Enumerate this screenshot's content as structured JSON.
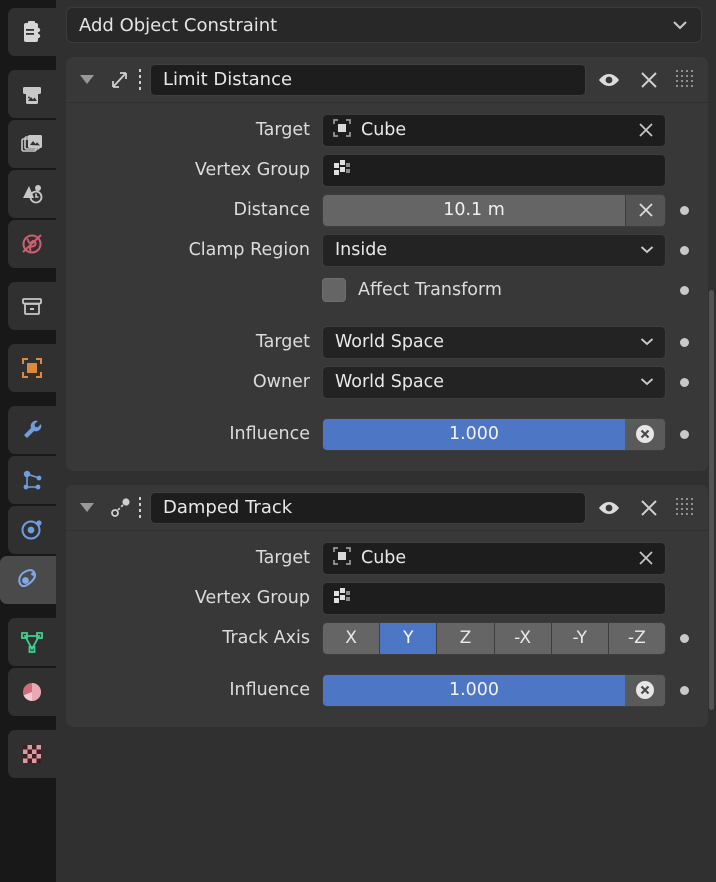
{
  "theme": {
    "accent_blue": "#4d76c4",
    "panel_bg": "#383838",
    "area_bg": "#303030",
    "field_bg": "#1d1d1d",
    "slider_track": "#656565"
  },
  "tabstrip": {
    "items": [
      {
        "name": "tool",
        "icon": "tool-clipboard-icon",
        "active": false
      },
      {
        "name": "render",
        "icon": "render-camera-icon",
        "active": false
      },
      {
        "name": "output",
        "icon": "output-printer-icon",
        "active": false
      },
      {
        "name": "view-layer",
        "icon": "view-layer-images-icon",
        "active": false
      },
      {
        "name": "scene",
        "icon": "scene-cone-icon",
        "active": false
      },
      {
        "name": "world",
        "icon": "world-globe-icon",
        "active": false
      },
      {
        "name": "collection",
        "icon": "collection-box-icon",
        "active": false
      },
      {
        "name": "object",
        "icon": "object-square-icon",
        "active": false
      },
      {
        "name": "modifiers",
        "icon": "wrench-icon",
        "active": false
      },
      {
        "name": "particles",
        "icon": "particles-icon",
        "active": false
      },
      {
        "name": "physics",
        "icon": "physics-orbit-icon",
        "active": false
      },
      {
        "name": "object-constraints",
        "icon": "constraint-icon",
        "active": true
      },
      {
        "name": "object-data",
        "icon": "mesh-data-icon",
        "active": false
      },
      {
        "name": "material",
        "icon": "material-sphere-icon",
        "active": false
      },
      {
        "name": "texture",
        "icon": "texture-checker-icon",
        "active": false
      }
    ]
  },
  "add_constraint": {
    "label": "Add Object Constraint",
    "icon": "chevron-down-icon"
  },
  "constraints": [
    {
      "id": "limit-distance",
      "name": "Limit Distance",
      "icon": "limit-distance-icon",
      "expanded": true,
      "visibility_icon": "eye-icon",
      "delete_icon": "close-x-icon",
      "grip_icon": "drag-grip-icon",
      "rows": [
        {
          "kind": "object",
          "label": "Target",
          "value": "Cube",
          "icon": "object-square-icon",
          "clear_icon": "close-x-icon",
          "decorator": false
        },
        {
          "kind": "vgroup",
          "label": "Vertex Group",
          "value": "",
          "icon": "vertex-group-icon",
          "decorator": false
        },
        {
          "kind": "number",
          "label": "Distance",
          "value": "10.1 m",
          "clear_icon": "close-x-icon",
          "decorator": true
        },
        {
          "kind": "enum",
          "label": "Clamp Region",
          "value": "Inside",
          "icon": "chevron-down-icon",
          "decorator": true
        },
        {
          "kind": "checkbox",
          "label": "Affect Transform",
          "checked": false,
          "decorator": true
        },
        {
          "kind": "enum",
          "label": "Target",
          "value": "World Space",
          "icon": "chevron-down-icon",
          "decorator": true,
          "spaced": true
        },
        {
          "kind": "enum",
          "label": "Owner",
          "value": "World Space",
          "icon": "chevron-down-icon",
          "decorator": true
        },
        {
          "kind": "slider",
          "label": "Influence",
          "value": "1.000",
          "fill_percent": 100,
          "reset_icon": "reset-circle-x-icon",
          "decorator": true,
          "spaced": true
        }
      ]
    },
    {
      "id": "damped-track",
      "name": "Damped Track",
      "icon": "damped-track-icon",
      "expanded": true,
      "visibility_icon": "eye-icon",
      "delete_icon": "close-x-icon",
      "grip_icon": "drag-grip-icon",
      "rows": [
        {
          "kind": "object",
          "label": "Target",
          "value": "Cube",
          "icon": "object-square-icon",
          "clear_icon": "close-x-icon",
          "decorator": false
        },
        {
          "kind": "vgroup",
          "label": "Vertex Group",
          "value": "",
          "icon": "vertex-group-icon",
          "decorator": false
        },
        {
          "kind": "axis",
          "label": "Track Axis",
          "options": [
            "X",
            "Y",
            "Z",
            "-X",
            "-Y",
            "-Z"
          ],
          "selected": "Y",
          "decorator": true
        },
        {
          "kind": "slider",
          "label": "Influence",
          "value": "1.000",
          "fill_percent": 100,
          "reset_icon": "reset-circle-x-icon",
          "decorator": true,
          "spaced": true
        }
      ]
    }
  ]
}
